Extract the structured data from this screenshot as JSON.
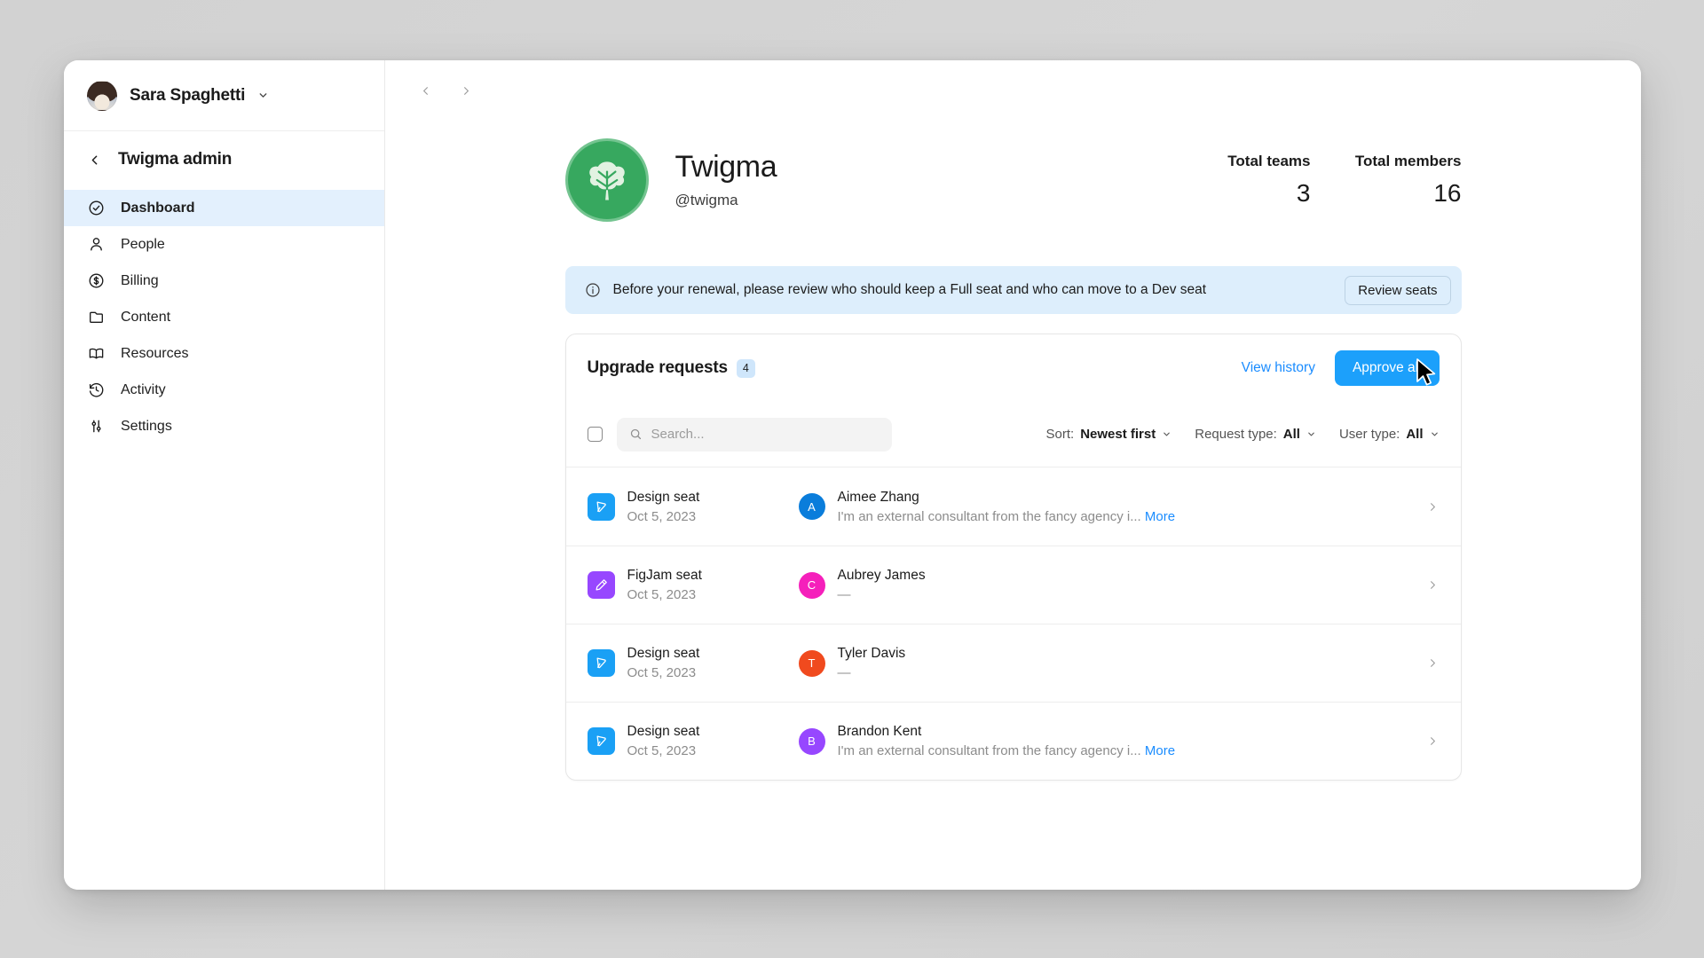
{
  "sidebar": {
    "user": {
      "name": "Sara Spaghetti",
      "avatar_icon": "user-photo-avatar",
      "chevron_icon": "chevron-down-icon"
    },
    "admin_header": {
      "label": "Twigma admin",
      "back_icon": "chevron-left-icon"
    },
    "items": [
      {
        "label": "Dashboard",
        "icon": "check-circle-icon",
        "active": true
      },
      {
        "label": "People",
        "icon": "person-icon",
        "active": false
      },
      {
        "label": "Billing",
        "icon": "dollar-circle-icon",
        "active": false
      },
      {
        "label": "Content",
        "icon": "folder-icon",
        "active": false
      },
      {
        "label": "Resources",
        "icon": "book-icon",
        "active": false
      },
      {
        "label": "Activity",
        "icon": "history-clock-icon",
        "active": false
      },
      {
        "label": "Settings",
        "icon": "sliders-icon",
        "active": false
      }
    ],
    "active_bg": "#e3f0fd"
  },
  "topbar": {
    "back_icon": "chevron-left-icon",
    "forward_icon": "chevron-right-icon"
  },
  "org": {
    "logo_icon": "monstera-leaf-logo",
    "logo_bg": "#37a85f",
    "logo_ring": "#74c490",
    "name": "Twigma",
    "handle": "@twigma",
    "stats": [
      {
        "label": "Total teams",
        "value": "3"
      },
      {
        "label": "Total members",
        "value": "16"
      }
    ]
  },
  "banner": {
    "icon": "info-circle-icon",
    "bg": "#ddeefc",
    "text": "Before your renewal, please review who should keep a Full seat and who can move to a Dev seat",
    "button_label": "Review seats"
  },
  "card": {
    "title": "Upgrade requests",
    "count": "4",
    "count_bg": "#cfe6fb",
    "view_history_label": "View history",
    "approve_all_label": "Approve all",
    "approve_all_bg": "#1ca0fb",
    "toolbar": {
      "select_all_icon": "checkbox-icon",
      "search_icon": "search-icon",
      "search_value": "",
      "search_placeholder": "Search...",
      "filters": [
        {
          "prefix": "Sort: ",
          "value": "Newest first",
          "icon": "chevron-down-icon"
        },
        {
          "prefix": "Request type: ",
          "value": "All",
          "icon": "chevron-down-icon"
        },
        {
          "prefix": "User type: ",
          "value": "All",
          "icon": "chevron-down-icon"
        }
      ]
    },
    "rows": [
      {
        "seat_type": "Design seat",
        "seat_icon": "pen-tool-icon",
        "seat_icon_bg": "#1aa0f5",
        "date": "Oct 5, 2023",
        "person_initial": "A",
        "person_avatar_bg": "#0a7ddb",
        "person_name": "Aimee Zhang",
        "note": "I'm an external consultant from the fancy agency i...",
        "more_label": "More",
        "chevron_icon": "chevron-right-icon"
      },
      {
        "seat_type": "FigJam seat",
        "seat_icon": "marker-pen-icon",
        "seat_icon_bg": "#9747ff",
        "date": "Oct 5, 2023",
        "person_initial": "C",
        "person_avatar_bg": "#f520bb",
        "person_name": "Aubrey James",
        "note": "—",
        "more_label": "",
        "chevron_icon": "chevron-right-icon"
      },
      {
        "seat_type": "Design seat",
        "seat_icon": "pen-tool-icon",
        "seat_icon_bg": "#1aa0f5",
        "date": "Oct 5, 2023",
        "person_initial": "T",
        "person_avatar_bg": "#f04a1e",
        "person_name": "Tyler Davis",
        "note": "—",
        "more_label": "",
        "chevron_icon": "chevron-right-icon"
      },
      {
        "seat_type": "Design seat",
        "seat_icon": "pen-tool-icon",
        "seat_icon_bg": "#1aa0f5",
        "date": "Oct 5, 2023",
        "person_initial": "B",
        "person_avatar_bg": "#9747ff",
        "person_name": "Brandon Kent",
        "note": "I'm an external consultant from the fancy agency i...",
        "more_label": "More",
        "chevron_icon": "chevron-right-icon"
      }
    ]
  },
  "cursor": {
    "icon": "mouse-pointer-icon"
  }
}
